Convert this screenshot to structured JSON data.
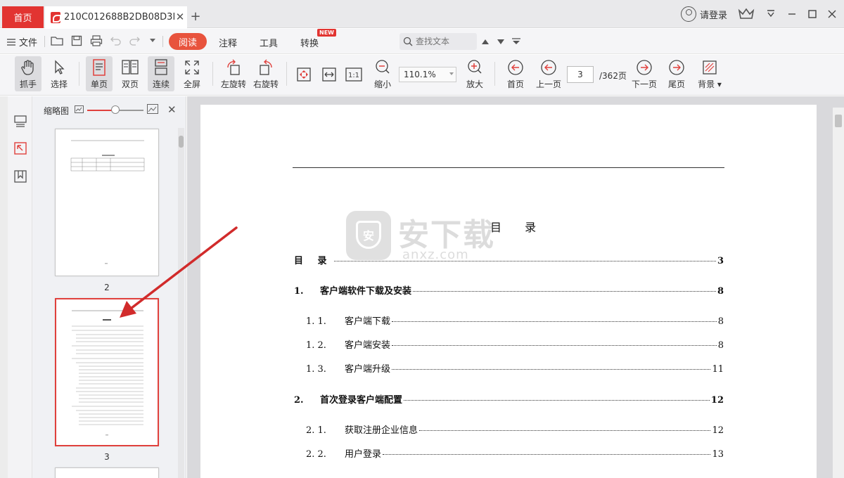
{
  "tabs": {
    "home": "首页",
    "doc_title": "210C012688B2DB08D3E5..."
  },
  "header": {
    "login_label": "请登录"
  },
  "menu": {
    "file": "文件",
    "tabs": [
      "阅读",
      "注释",
      "工具",
      "转换"
    ],
    "new_badge": "NEW",
    "search_placeholder": "查找文本"
  },
  "toolbar": {
    "hand": "抓手",
    "select": "选择",
    "single": "单页",
    "double": "双页",
    "continuous": "连续",
    "fullscreen": "全屏",
    "rotate_left": "左旋转",
    "rotate_right": "右旋转",
    "zoom_out": "缩小",
    "zoom_value": "110.1%",
    "zoom_in": "放大",
    "first": "首页",
    "prev": "上一页",
    "page_current": "3",
    "page_total": "/362页",
    "next": "下一页",
    "last": "尾页",
    "background": "背景"
  },
  "thumbnails": {
    "title": "缩略图",
    "pages": [
      "2",
      "3"
    ]
  },
  "document": {
    "toc_title": "目 录",
    "entries": [
      {
        "num": "目 录",
        "title": "",
        "page": "3",
        "bold": true,
        "indent": false
      },
      {
        "num": "1.",
        "title": "客户端软件下载及安装",
        "page": "8",
        "bold": true,
        "indent": false
      },
      {
        "num": "1. 1.",
        "title": "客户端下载",
        "page": "8",
        "bold": false,
        "indent": true
      },
      {
        "num": "1. 2.",
        "title": "客户端安装",
        "page": "8",
        "bold": false,
        "indent": true
      },
      {
        "num": "1. 3.",
        "title": "客户端升级",
        "page": "11",
        "bold": false,
        "indent": true
      },
      {
        "num": "2.",
        "title": "首次登录客户端配置",
        "page": "12",
        "bold": true,
        "indent": false
      },
      {
        "num": "2. 1.",
        "title": "获取注册企业信息",
        "page": "12",
        "bold": false,
        "indent": true
      },
      {
        "num": "2. 2.",
        "title": "用户登录",
        "page": "13",
        "bold": false,
        "indent": true
      }
    ]
  },
  "watermark": {
    "text": "安下载",
    "sub": "anxz.com"
  },
  "colors": {
    "accent": "#e23431",
    "read_tab": "#e8533d",
    "annotation_arrow": "#d12b2b"
  }
}
